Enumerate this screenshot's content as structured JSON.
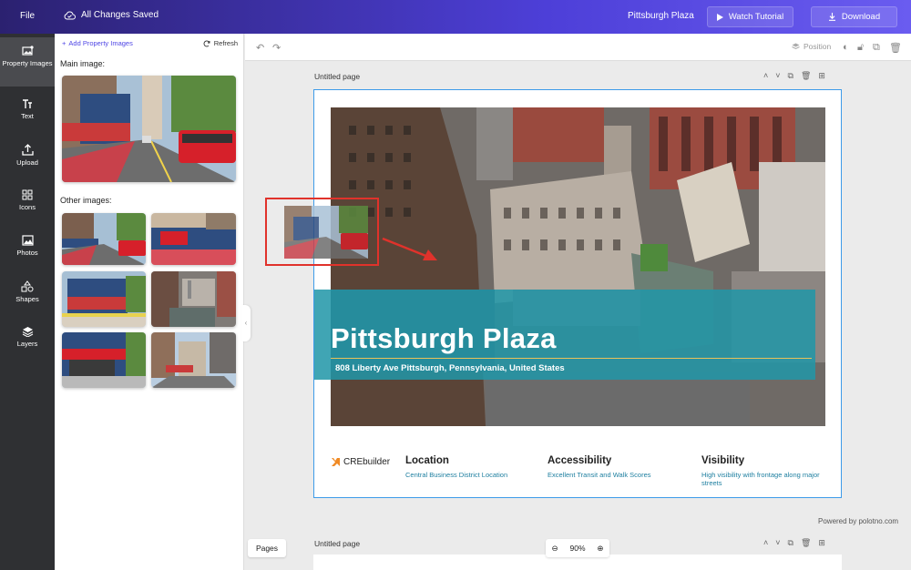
{
  "topbar": {
    "file": "File",
    "saved": "All Changes Saved",
    "project": "Pittsburgh Plaza",
    "watch": "Watch Tutorial",
    "download": "Download"
  },
  "rail": [
    {
      "label": "Property Images",
      "icon": "image-icon"
    },
    {
      "label": "Text",
      "icon": "text-icon"
    },
    {
      "label": "Upload",
      "icon": "upload-icon"
    },
    {
      "label": "Icons",
      "icon": "grid-icon"
    },
    {
      "label": "Photos",
      "icon": "photo-icon"
    },
    {
      "label": "Shapes",
      "icon": "shapes-icon"
    },
    {
      "label": "Layers",
      "icon": "layers-icon"
    }
  ],
  "panel": {
    "add": "Add Property Images",
    "refresh": "Refresh",
    "main_label": "Main image:",
    "other_label": "Other images:"
  },
  "toolbar": {
    "position": "Position"
  },
  "page": {
    "title": "Untitled page",
    "title2": "Untitled page",
    "banner_title": "Pittsburgh Plaza",
    "address": "808 Liberty Ave Pittsburgh, Pennsylvania, United States",
    "logo": "CREbuilder",
    "features": [
      {
        "title": "Location",
        "desc": "Central Business District Location"
      },
      {
        "title": "Accessibility",
        "desc": "Excellent Transit and Walk Scores"
      },
      {
        "title": "Visibility",
        "desc": "High visibility with frontage along major streets"
      }
    ]
  },
  "footer": {
    "powered": "Powered by polotno.com",
    "pages": "Pages",
    "zoom": "90%"
  },
  "colors": {
    "accent": "#4f46e5",
    "banner": "#2196a8",
    "highlight": "#e0322b"
  }
}
